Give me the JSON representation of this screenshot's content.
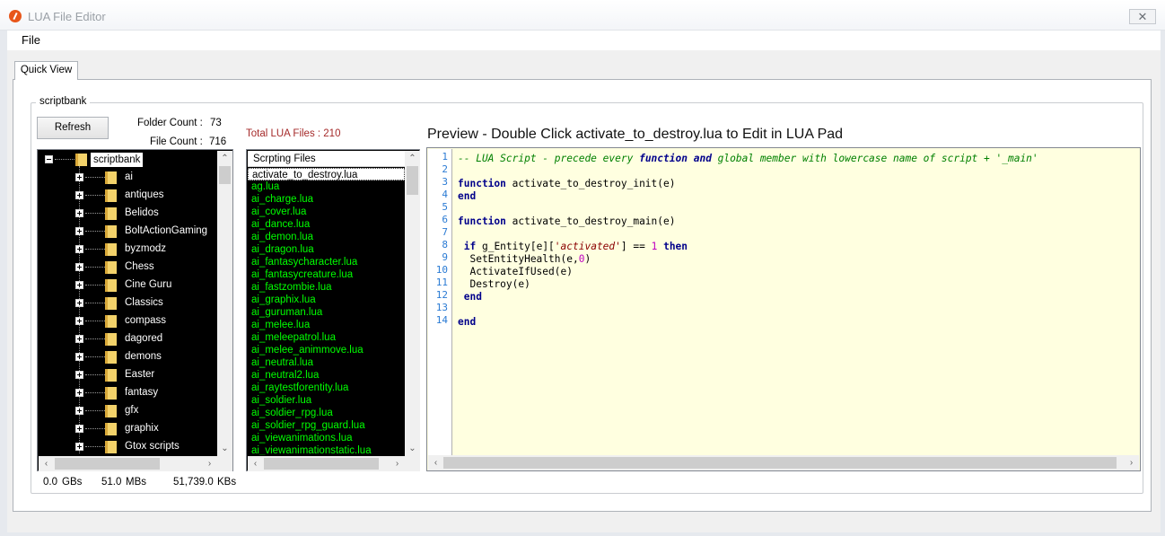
{
  "window": {
    "title": "LUA File Editor",
    "close_glyph": "✕"
  },
  "menu": {
    "file_label": "File"
  },
  "tabs": [
    {
      "label": "Quick View"
    }
  ],
  "group": {
    "legend": "scriptbank"
  },
  "refresh_label": "Refresh",
  "stats": {
    "folder_count_label": "Folder Count :",
    "folder_count": "73",
    "file_count_label": "File Count :",
    "file_count": "716",
    "total_lua": "Total LUA Files : 210"
  },
  "tree": {
    "root": "scriptbank",
    "items": [
      "ai",
      "antiques",
      "Belidos",
      "BoltActionGaming",
      "byzmodz",
      "Chess",
      "Cine Guru",
      "Classics",
      "compass",
      "dagored",
      "demons",
      "Easter",
      "fantasy",
      "gfx",
      "graphix",
      "Gtox scripts"
    ]
  },
  "files": {
    "header": "Scrpting Files",
    "selected_index": 0,
    "items": [
      "activate_to_destroy.lua",
      "ag.lua",
      "ai_charge.lua",
      "ai_cover.lua",
      "ai_dance.lua",
      "ai_demon.lua",
      "ai_dragon.lua",
      "ai_fantasycharacter.lua",
      "ai_fantasycreature.lua",
      "ai_fastzombie.lua",
      "ai_graphix.lua",
      "ai_guruman.lua",
      "ai_melee.lua",
      "ai_meleepatrol.lua",
      "ai_melee_animmove.lua",
      "ai_neutral.lua",
      "ai_neutral2.lua",
      "ai_raytestforentity.lua",
      "ai_soldier.lua",
      "ai_soldier_rpg.lua",
      "ai_soldier_rpg_guard.lua",
      "ai_viewanimations.lua",
      "ai_viewanimationstatic.lua"
    ]
  },
  "preview": {
    "title": "Preview - Double Click activate_to_destroy.lua to Edit in LUA Pad",
    "line_numbers": [
      "1",
      "2",
      "3",
      "4",
      "5",
      "6",
      "7",
      "8",
      "9",
      "10",
      "11",
      "12",
      "13",
      "14"
    ],
    "lines": [
      [
        {
          "t": "-- LUA Script - precede every ",
          "c": "cm"
        },
        {
          "t": "function",
          "c": "cmkw"
        },
        {
          "t": " ",
          "c": "cm"
        },
        {
          "t": "and",
          "c": "cmkw"
        },
        {
          "t": " global member with lowercase name of script + '_main'",
          "c": "cm"
        }
      ],
      [],
      [
        {
          "t": "function",
          "c": "kw"
        },
        {
          "t": " activate_to_destroy_init(e)",
          "c": ""
        }
      ],
      [
        {
          "t": "end",
          "c": "kw"
        }
      ],
      [],
      [
        {
          "t": "function",
          "c": "kw"
        },
        {
          "t": " activate_to_destroy_main(e)",
          "c": ""
        }
      ],
      [],
      [
        {
          "t": " ",
          "c": ""
        },
        {
          "t": "if",
          "c": "kw"
        },
        {
          "t": " g_Entity[e][",
          "c": ""
        },
        {
          "t": "'activated'",
          "c": "st"
        },
        {
          "t": "] == ",
          "c": ""
        },
        {
          "t": "1",
          "c": "nm"
        },
        {
          "t": " ",
          "c": ""
        },
        {
          "t": "then",
          "c": "kw"
        }
      ],
      [
        {
          "t": "  SetEntityHealth(e,",
          "c": ""
        },
        {
          "t": "0",
          "c": "nm"
        },
        {
          "t": ")",
          "c": ""
        }
      ],
      [
        {
          "t": "  ActivateIfUsed(e)",
          "c": ""
        }
      ],
      [
        {
          "t": "  Destroy(e)",
          "c": ""
        }
      ],
      [
        {
          "t": " ",
          "c": ""
        },
        {
          "t": "end",
          "c": "kw"
        }
      ],
      [],
      [
        {
          "t": "end",
          "c": "kw"
        }
      ]
    ]
  },
  "sizes": {
    "gbs": "0.0",
    "gbs_unit": "GBs",
    "mbs": "51.0",
    "mbs_unit": "MBs",
    "kbs": "51,739.0",
    "kbs_unit": "KBs"
  },
  "colors": {
    "file_text": "#00ff00",
    "list_background": "#000000",
    "code_background": "#ffffe0",
    "total_lua_text": "#a52a2a"
  },
  "icons": {
    "app": "app-icon",
    "folder": "folder-icon",
    "expander": "plus-box-icon"
  }
}
